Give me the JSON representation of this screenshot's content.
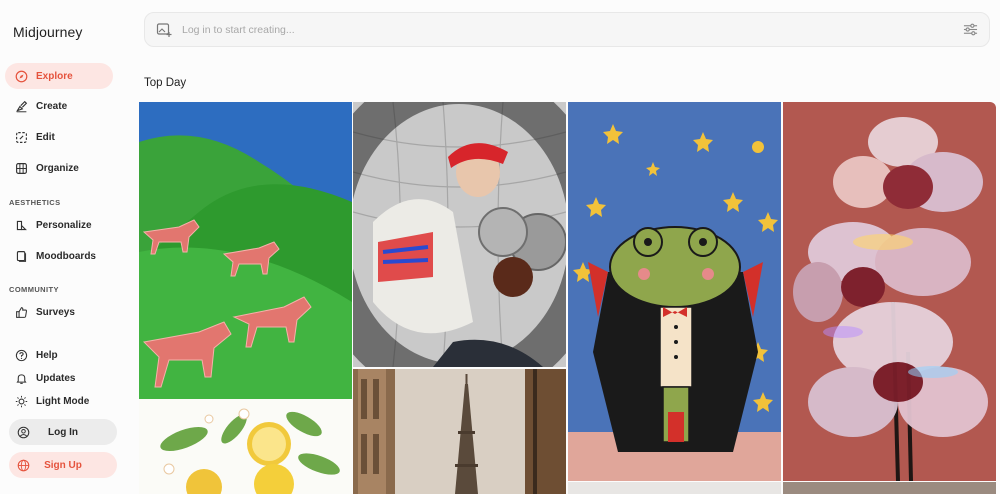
{
  "app": {
    "brand": "Midjourney"
  },
  "sidebar": {
    "nav": [
      {
        "label": "Explore",
        "icon": "compass-icon",
        "active": true
      },
      {
        "label": "Create",
        "icon": "brush-icon",
        "active": false
      },
      {
        "label": "Edit",
        "icon": "edit-image-icon",
        "active": false
      },
      {
        "label": "Organize",
        "icon": "grid-icon",
        "active": false
      }
    ],
    "aesthetics_label": "AESTHETICS",
    "aesthetics": [
      {
        "label": "Personalize",
        "icon": "personalize-icon"
      },
      {
        "label": "Moodboards",
        "icon": "moodboard-icon"
      }
    ],
    "community_label": "COMMUNITY",
    "community": [
      {
        "label": "Surveys",
        "icon": "thumbs-up-icon"
      }
    ],
    "footer": [
      {
        "label": "Help",
        "icon": "help-icon"
      },
      {
        "label": "Updates",
        "icon": "bell-icon"
      },
      {
        "label": "Light Mode",
        "icon": "sun-icon"
      }
    ],
    "login_label": "Log In",
    "signup_label": "Sign Up"
  },
  "search": {
    "placeholder": "Log in to start creating..."
  },
  "main": {
    "section_title": "Top Day"
  },
  "colors": {
    "accent": "#e5533d",
    "accent_bg": "#fde6e3"
  }
}
